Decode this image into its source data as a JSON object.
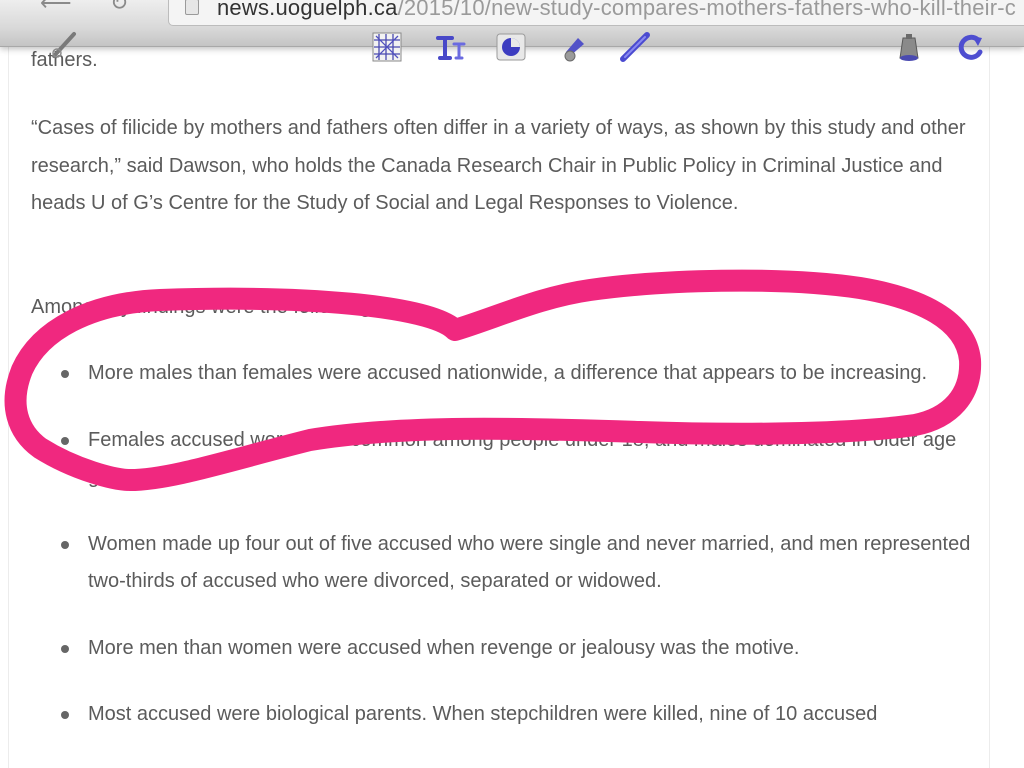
{
  "browser": {
    "url_host": "news.uoguelph.ca",
    "url_path": "/2015/10/new-study-compares-mothers-fathers-who-kill-their-c"
  },
  "toolbar": {
    "tools": [
      "grid-tool-icon",
      "text-tool-icon",
      "shape-tool-icon",
      "stamp-tool-icon",
      "pen-tool-icon",
      "bell-icon",
      "redo-icon"
    ]
  },
  "article": {
    "fragment": "fathers.",
    "quote": "“Cases of filicide by mothers and fathers often differ in a variety of ways, as shown by this study and other research,” said Dawson, who holds the Canada Research Chair in Public Policy in Criminal Justice and heads U of G’s Centre for the Study of Social and Legal Responses to Violence.",
    "among": "Among key findings were the following:",
    "findings": [
      "More males than females were accused nationwide, a difference that appears to be increasing.",
      "Females accused were more common among people under 18, and males dominated in older age groups.",
      "Women made up four out of five accused who were single and never married, and men represented two-thirds of accused who were divorced, separated or widowed.",
      "More men than women were accused when revenge or jealousy was the motive.",
      "Most accused were biological parents. When stepchildren were killed, nine of 10 accused"
    ]
  },
  "annotation": {
    "color": "#f0287f"
  }
}
